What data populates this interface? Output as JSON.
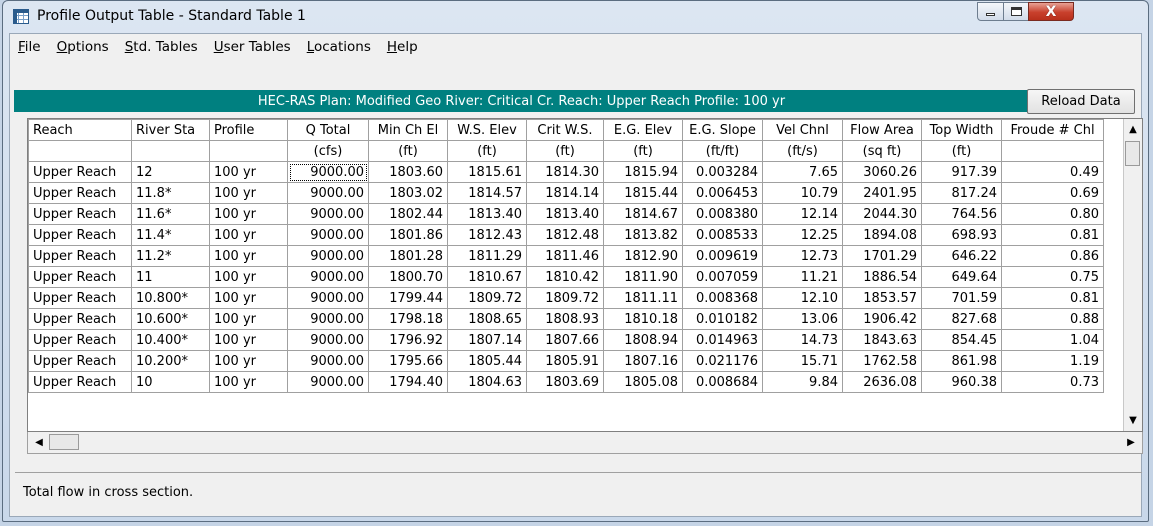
{
  "window": {
    "title": "Profile Output Table - Standard Table 1",
    "controls": {
      "minimize": "–",
      "maximize": "□",
      "close": "X"
    }
  },
  "menu": [
    {
      "underline": "F",
      "rest": "ile"
    },
    {
      "underline": "O",
      "rest": "ptions"
    },
    {
      "underline": "S",
      "rest": "td. Tables"
    },
    {
      "underline": "U",
      "rest": "ser Tables"
    },
    {
      "underline": "L",
      "rest": "ocations"
    },
    {
      "underline": "H",
      "rest": "elp"
    }
  ],
  "info_bar": "HEC-RAS  Plan: Modified Geo   River: Critical Cr.   Reach: Upper Reach   Profile: 100 yr",
  "reload_button": "Reload Data",
  "table": {
    "headers": [
      "Reach",
      "River Sta",
      "Profile",
      "Q Total",
      "Min Ch El",
      "W.S. Elev",
      "Crit W.S.",
      "E.G. Elev",
      "E.G. Slope",
      "Vel Chnl",
      "Flow Area",
      "Top Width",
      "Froude # Chl"
    ],
    "units": [
      "",
      "",
      "",
      "(cfs)",
      "(ft)",
      "(ft)",
      "(ft)",
      "(ft)",
      "(ft/ft)",
      "(ft/s)",
      "(sq ft)",
      "(ft)",
      ""
    ],
    "rows": [
      [
        "Upper Reach",
        "12",
        "100 yr",
        "9000.00",
        "1803.60",
        "1815.61",
        "1814.30",
        "1815.94",
        "0.003284",
        "7.65",
        "3060.26",
        "917.39",
        "0.49"
      ],
      [
        "Upper Reach",
        "11.8*",
        "100 yr",
        "9000.00",
        "1803.02",
        "1814.57",
        "1814.14",
        "1815.44",
        "0.006453",
        "10.79",
        "2401.95",
        "817.24",
        "0.69"
      ],
      [
        "Upper Reach",
        "11.6*",
        "100 yr",
        "9000.00",
        "1802.44",
        "1813.40",
        "1813.40",
        "1814.67",
        "0.008380",
        "12.14",
        "2044.30",
        "764.56",
        "0.80"
      ],
      [
        "Upper Reach",
        "11.4*",
        "100 yr",
        "9000.00",
        "1801.86",
        "1812.43",
        "1812.48",
        "1813.82",
        "0.008533",
        "12.25",
        "1894.08",
        "698.93",
        "0.81"
      ],
      [
        "Upper Reach",
        "11.2*",
        "100 yr",
        "9000.00",
        "1801.28",
        "1811.29",
        "1811.46",
        "1812.90",
        "0.009619",
        "12.73",
        "1701.29",
        "646.22",
        "0.86"
      ],
      [
        "Upper Reach",
        "11",
        "100 yr",
        "9000.00",
        "1800.70",
        "1810.67",
        "1810.42",
        "1811.90",
        "0.007059",
        "11.21",
        "1886.54",
        "649.64",
        "0.75"
      ],
      [
        "Upper Reach",
        "10.800*",
        "100 yr",
        "9000.00",
        "1799.44",
        "1809.72",
        "1809.72",
        "1811.11",
        "0.008368",
        "12.10",
        "1853.57",
        "701.59",
        "0.81"
      ],
      [
        "Upper Reach",
        "10.600*",
        "100 yr",
        "9000.00",
        "1798.18",
        "1808.65",
        "1808.93",
        "1810.18",
        "0.010182",
        "13.06",
        "1906.42",
        "827.68",
        "0.88"
      ],
      [
        "Upper Reach",
        "10.400*",
        "100 yr",
        "9000.00",
        "1796.92",
        "1807.14",
        "1807.66",
        "1808.94",
        "0.014963",
        "14.73",
        "1843.63",
        "854.45",
        "1.04"
      ],
      [
        "Upper Reach",
        "10.200*",
        "100 yr",
        "9000.00",
        "1795.66",
        "1805.44",
        "1805.91",
        "1807.16",
        "0.021176",
        "15.71",
        "1762.58",
        "861.98",
        "1.19"
      ],
      [
        "Upper Reach",
        "10",
        "100 yr",
        "9000.00",
        "1794.40",
        "1804.63",
        "1803.69",
        "1805.08",
        "0.008684",
        "9.84",
        "2636.08",
        "960.38",
        "0.73"
      ]
    ]
  },
  "status_text": "Total flow in cross section.",
  "colors": {
    "info_bar_bg": "#008080",
    "window_frame": "#c9d8ea",
    "close_button": "#c8402c"
  },
  "icons": {
    "app": "table-grid-icon",
    "scroll_up": "▲",
    "scroll_down": "▼",
    "scroll_left": "◀",
    "scroll_right": "▶"
  }
}
